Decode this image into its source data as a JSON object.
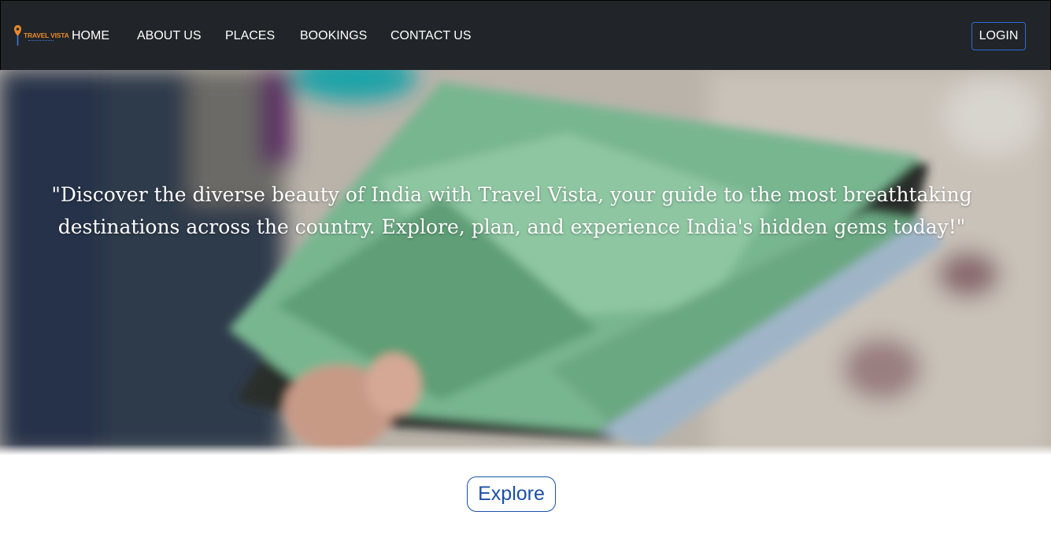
{
  "navbar": {
    "logo": {
      "brand_text": "TRAVEL VISTA"
    },
    "links": [
      {
        "label": "HOME"
      },
      {
        "label": "ABOUT US"
      },
      {
        "label": "PLACES"
      },
      {
        "label": "BOOKINGS"
      },
      {
        "label": "CONTACT US"
      }
    ],
    "login_label": "LOGIN"
  },
  "hero": {
    "quote": "\"Discover the diverse beauty of India with Travel Vista, your guide to the most breathtaking destinations across the country. Explore, plan, and experience India's hidden gems today!\""
  },
  "explore_label": "Explore",
  "colors": {
    "navbar_bg": "#212529",
    "accent_blue": "#1b4fa8",
    "logo_orange": "#e8892a"
  }
}
